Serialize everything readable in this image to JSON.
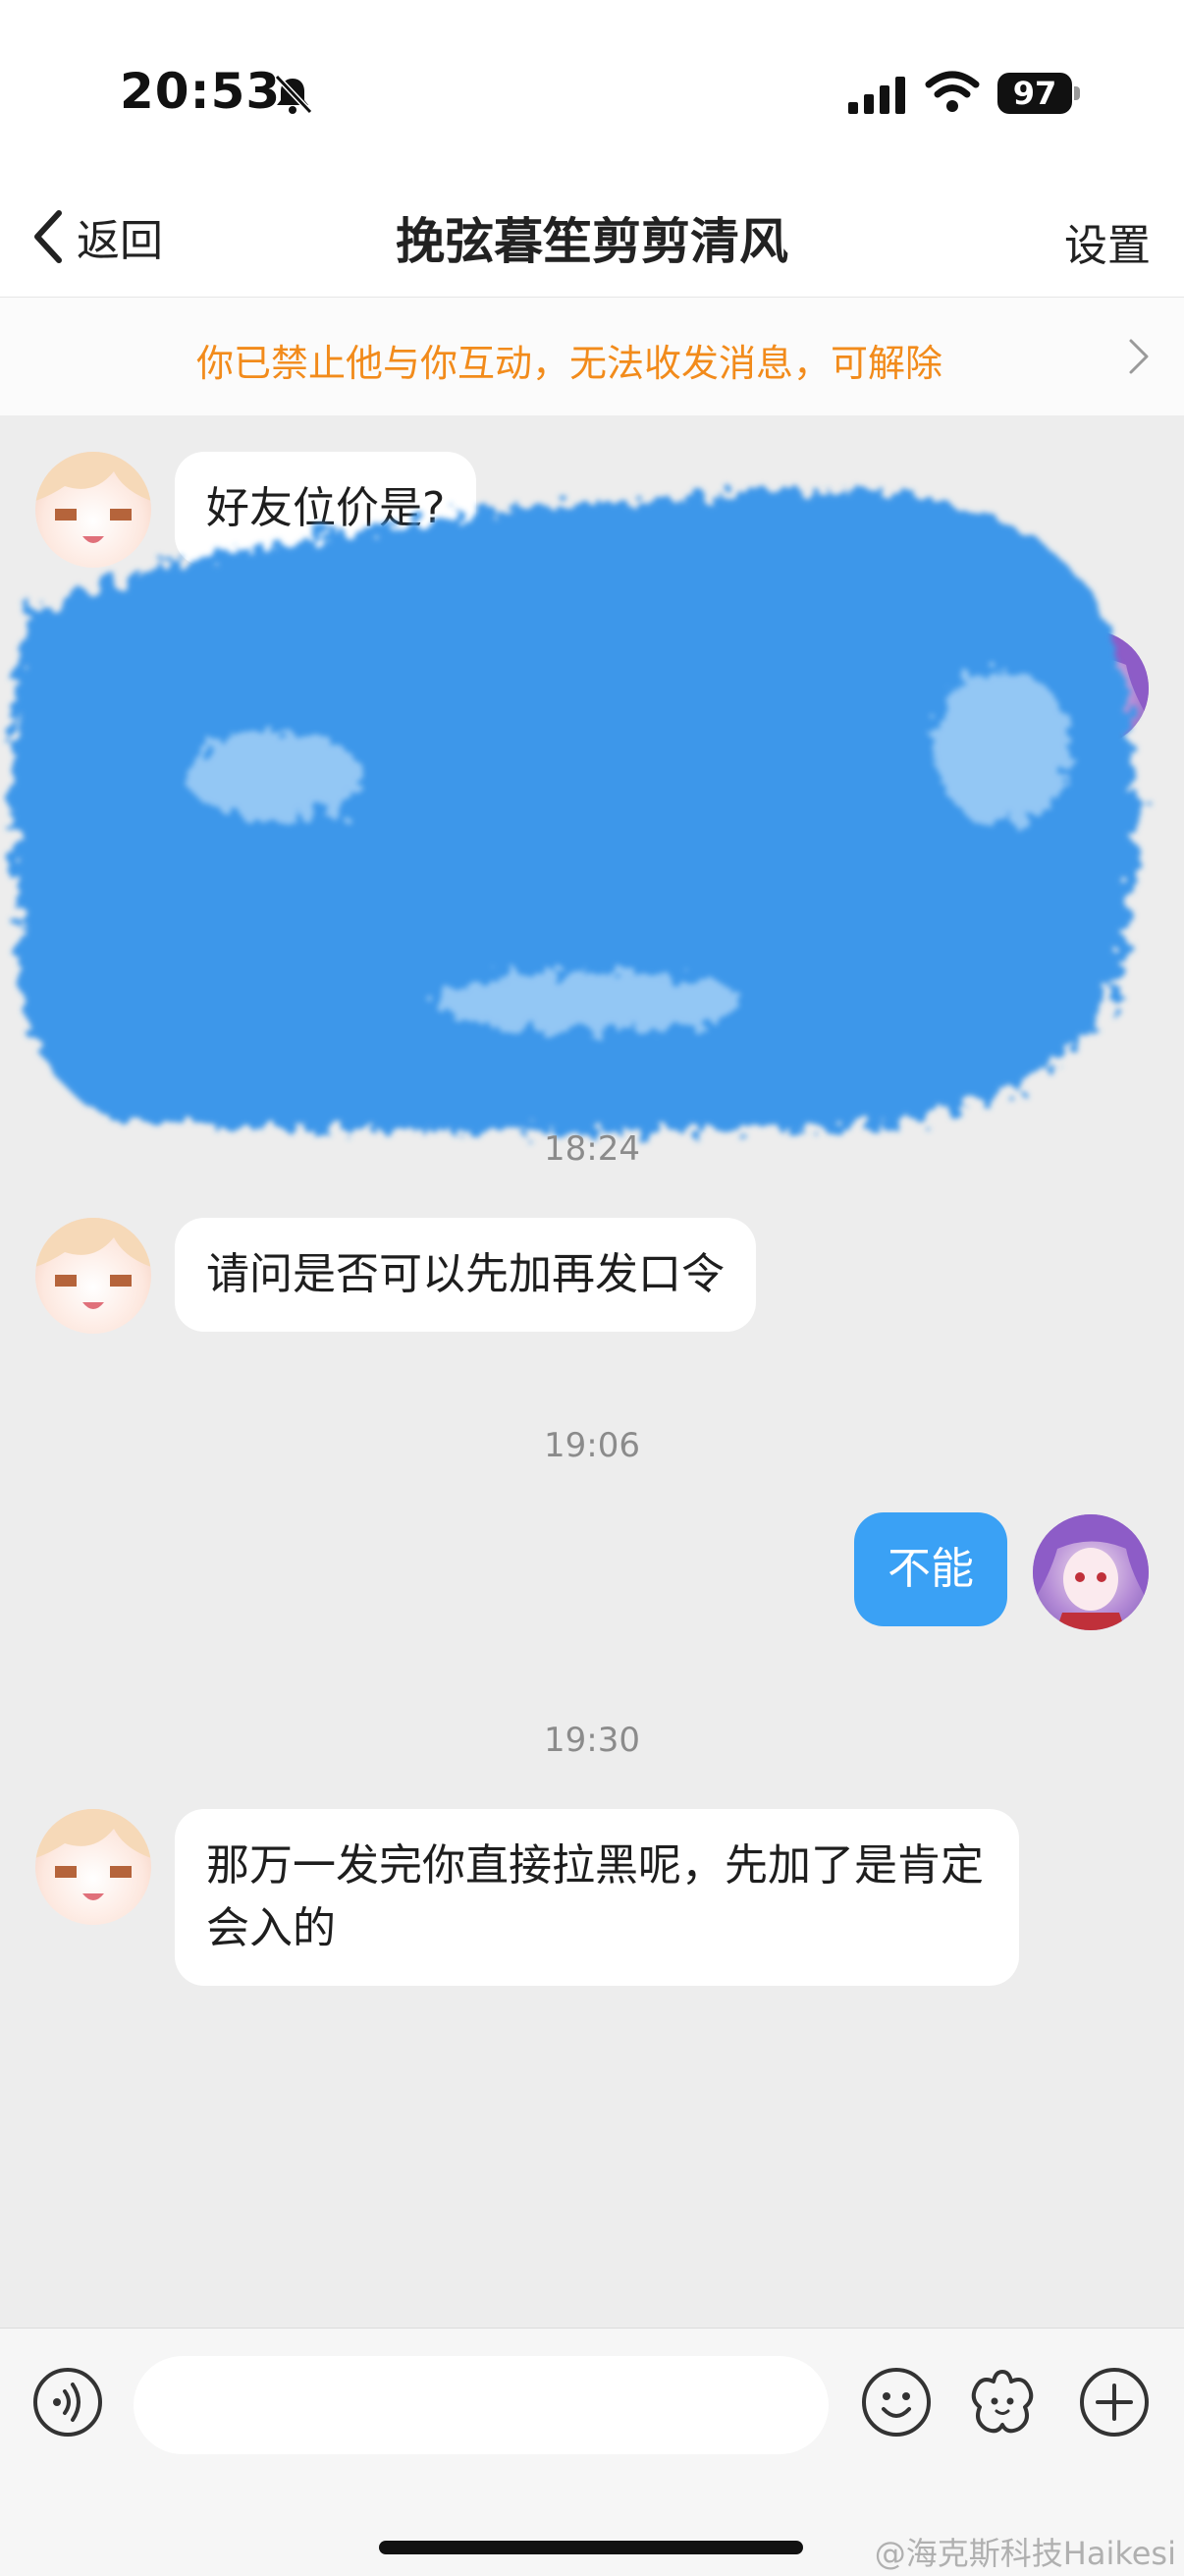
{
  "status_bar": {
    "time": "20:53",
    "battery": "97"
  },
  "nav": {
    "back_label": "返回",
    "title": "挽弦暮笙剪剪清风",
    "settings_label": "设置"
  },
  "banner": {
    "text": "你已禁止他与你互动，无法收发消息，可解除"
  },
  "messages": [
    {
      "side": "incoming",
      "text": "好友位价是?"
    },
    {
      "side": "outgoing",
      "text": ""
    },
    {
      "side": "incoming",
      "text": "请问是否可以先加再发口令"
    },
    {
      "side": "outgoing",
      "text": "不能"
    },
    {
      "side": "incoming",
      "text": "那万一发完你直接拉黑呢，先加了是肯定会入的"
    }
  ],
  "timestamps": [
    "18:24",
    "19:06",
    "19:30"
  ],
  "input": {
    "placeholder": ""
  },
  "watermark": "@海克斯科技Haikesi",
  "colors": {
    "accent_blue": "#3aa1f5",
    "banner_orange": "#f28b1b",
    "background": "#ededed"
  }
}
